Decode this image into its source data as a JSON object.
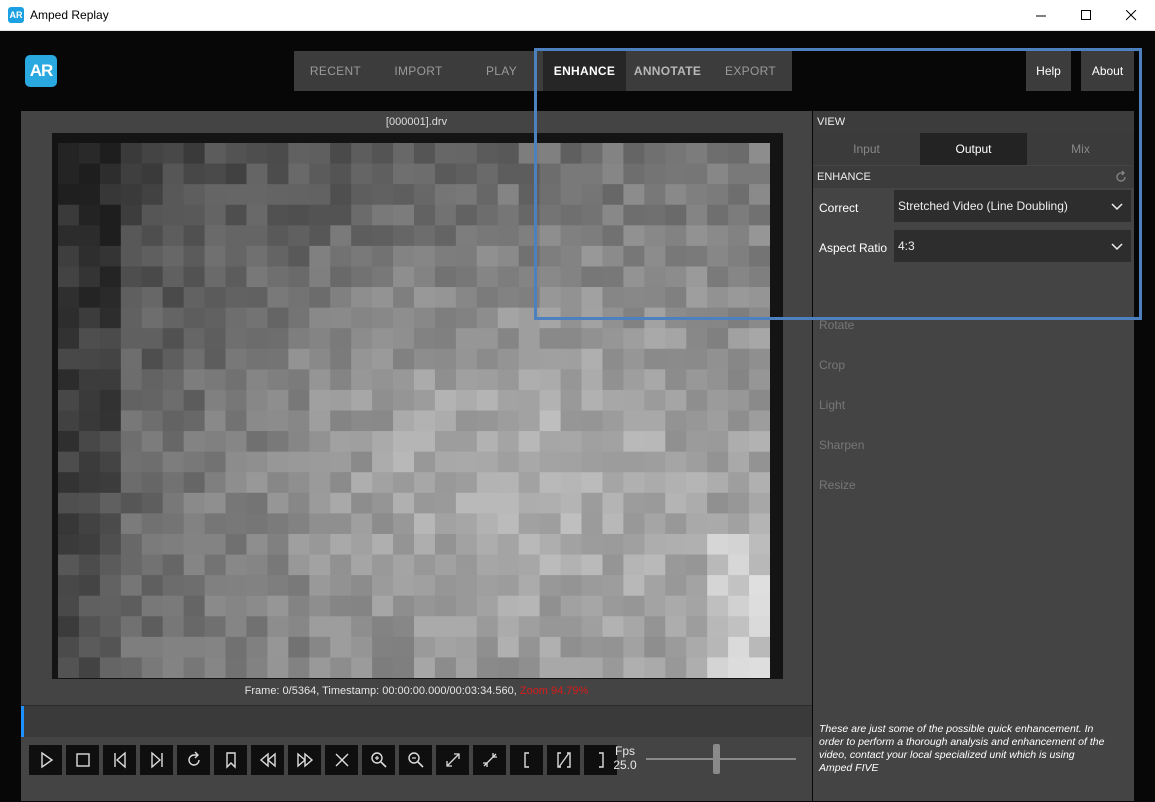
{
  "window": {
    "title": "Amped Replay",
    "icon_text": "AR",
    "minimize": "—",
    "maximize": "☐",
    "close": "✕"
  },
  "logo_text": "AR",
  "nav": {
    "tabs": [
      "RECENT",
      "IMPORT",
      "PLAY",
      "ENHANCE",
      "ANNOTATE",
      "EXPORT"
    ],
    "active": "ENHANCE"
  },
  "header_buttons": {
    "help": "Help",
    "about": "About"
  },
  "video": {
    "filename": "[000001].drv",
    "frame_info": "Frame: 0/5364, Timestamp: 00:00:00.000/00:03:34.560,",
    "zoom": "Zoom 94.79%"
  },
  "playback": {
    "fps_label": "Fps",
    "fps_value": "25.0",
    "controls": [
      "play-icon",
      "stop-icon",
      "step-back-icon",
      "step-forward-icon",
      "loop-icon",
      "bookmark-icon",
      "rewind-icon",
      "fast-forward-icon",
      "close-icon",
      "zoom-in-icon",
      "zoom-out-icon",
      "expand-icon",
      "shrink-icon",
      "mark-in-icon",
      "clear-marks-icon",
      "mark-out-icon"
    ]
  },
  "right_panel": {
    "view_header": "VIEW",
    "view_tabs": [
      "Input",
      "Output",
      "Mix"
    ],
    "active_view": "Output",
    "enhance_header": "ENHANCE",
    "correct": {
      "label": "Correct",
      "value": "Stretched Video (Line Doubling)"
    },
    "aspect_ratio": {
      "label": "Aspect Ratio",
      "value": "4:3"
    },
    "other_filters": [
      "Rotate",
      "Crop",
      "Light",
      "Sharpen",
      "Resize"
    ],
    "footnote": "These are just some of the possible quick enhancement. In order to perform a thorough analysis and enhancement of the video, contact your local specialized unit which is using Amped FIVE"
  },
  "colors": {
    "accent": "#2aa9e0",
    "highlight_box": "#4e7fbf",
    "zoom_text": "#d81b1b"
  }
}
